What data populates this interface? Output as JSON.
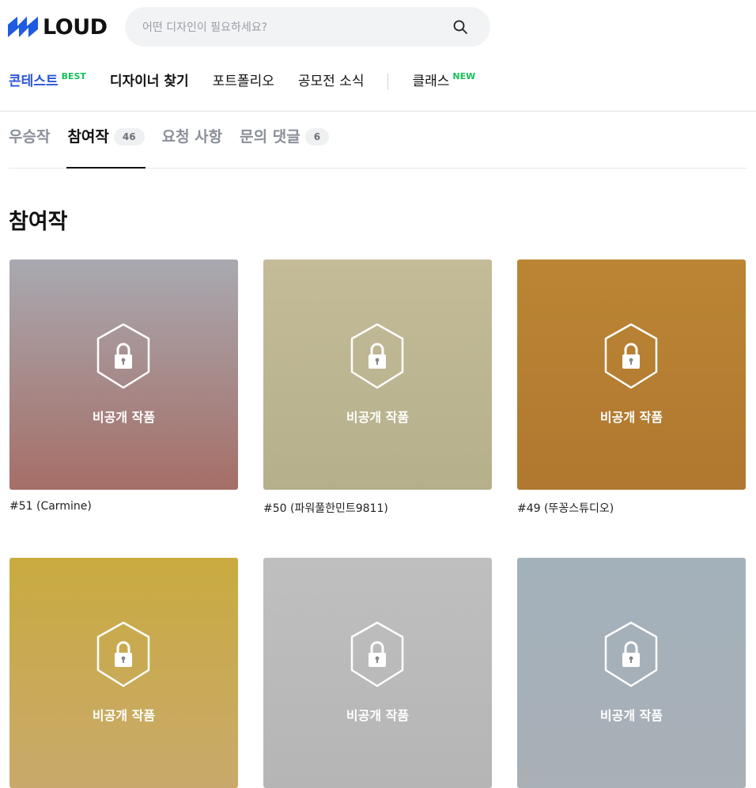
{
  "header": {
    "logo_text": "LOUD",
    "search_placeholder": "어떤 디자인이 필요하세요?"
  },
  "nav": {
    "contest": "콘테스트",
    "contest_badge": "BEST",
    "find_designer": "디자이너 찾기",
    "portfolio": "포트폴리오",
    "competition_news": "공모전 소식",
    "class": "클래스",
    "class_badge": "NEW"
  },
  "tabs": [
    {
      "label": "우승작"
    },
    {
      "label": "참여작",
      "count": "46"
    },
    {
      "label": "요청 사항"
    },
    {
      "label": "문의 댓글",
      "count": "6"
    }
  ],
  "section_title": "참여작",
  "private_label": "비공개 작품",
  "entries": [
    {
      "caption": "#51 (Carmine)",
      "color_top": "#a9a9b1",
      "color_bottom": "#a56e66"
    },
    {
      "caption": "#50 (파워풀한민트9811)",
      "color_top": "#c4bb98",
      "color_bottom": "#b5b08c"
    },
    {
      "caption": "#49 (뚜꽁스튜디오)",
      "color_top": "#bb8534",
      "color_bottom": "#b07830"
    },
    {
      "caption": "",
      "color_top": "#c9ab40",
      "color_bottom": "#c9a96b"
    },
    {
      "caption": "",
      "color_top": "#bfbfbf",
      "color_bottom": "#b5b5b5"
    },
    {
      "caption": "",
      "color_top": "#a3b1bb",
      "color_bottom": "#a9b0b6"
    }
  ]
}
